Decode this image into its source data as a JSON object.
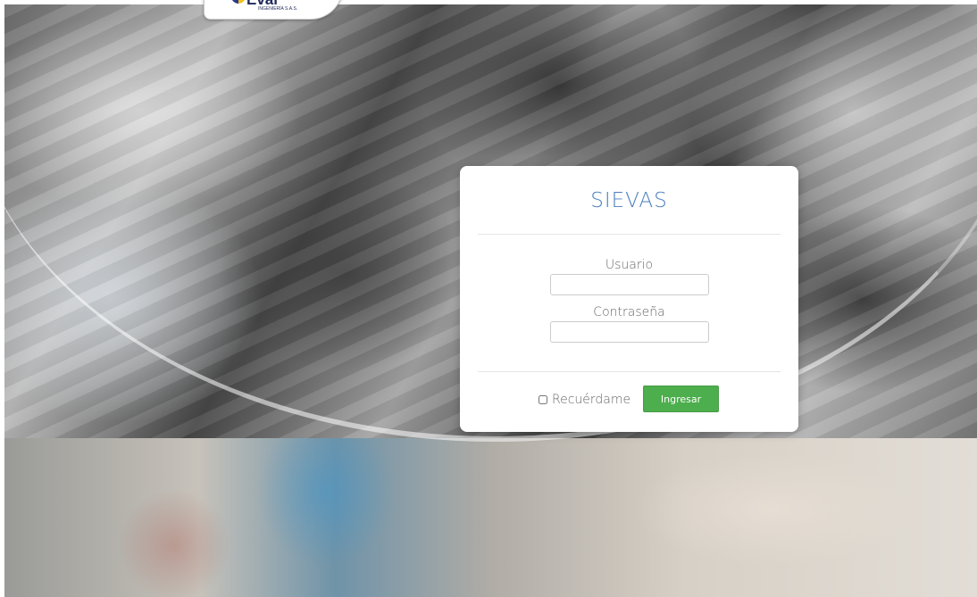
{
  "logo": {
    "wordmark": "Eval",
    "subtitle": "INGENIERÍA S.A.S."
  },
  "login": {
    "title": "SIEVAS",
    "username_label": "Usuario",
    "username_value": "",
    "password_label": "Contraseña",
    "password_value": "",
    "remember_label": "Recuérdame",
    "remember_checked": false,
    "submit_label": "Ingresar"
  },
  "colors": {
    "title": "#4a7fc1",
    "submit_button": "#4cae4c",
    "card_background": "#ffffff",
    "label_text": "#666666"
  }
}
